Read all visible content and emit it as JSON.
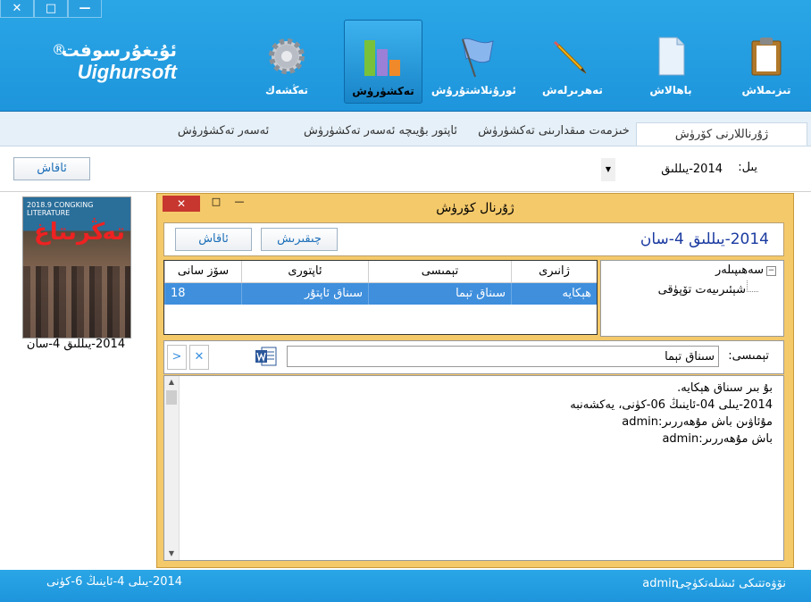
{
  "window": {
    "close": "✕",
    "maximize": "□",
    "minimize": "—"
  },
  "brand": {
    "uyghur": "ئۇيغۇرسوفت",
    "reg": "®",
    "latin": "Uighursoft"
  },
  "toolbar": [
    {
      "label": "تىزىملاش",
      "icon": "clipboard-icon"
    },
    {
      "label": "باھالاش",
      "icon": "document-icon"
    },
    {
      "label": "تەھرىرلەش",
      "icon": "pencil-icon"
    },
    {
      "label": "ئورۇنلاشتۇرۇش",
      "icon": "flag-icon"
    },
    {
      "label": "تەكشۈرۈش",
      "icon": "bar-chart-icon"
    },
    {
      "label": "تەڭشەك",
      "icon": "gear-icon"
    }
  ],
  "tabs": [
    "ژۇرناللارنى كۆرۈش",
    "خىزمەت مىقدارىنى تەكشۈرۈش",
    "ئاپتور بۇيىچە ئەسەر تەكشۈرۈش",
    "ئەسەر تەكشۈرۈش"
  ],
  "filter": {
    "year_label": "يىل:",
    "year_value": "2014-يىللىق",
    "search_button": "ئاقاش"
  },
  "cover": {
    "top_text": "2018.9 CONGKING LITERATURE",
    "title_glyph": "تەڭرىتاغ",
    "caption": "2014-يىللىق 4-سان"
  },
  "dialog": {
    "title": "ژۇرنال كۆرۈش",
    "close": "✕",
    "maximize": "□",
    "minimize": "—",
    "heading": "2014-يىللىق 4-سان",
    "btn_export": "چىقىرىش",
    "btn_search": "ئاقاش",
    "grid": {
      "headers": [
        "ژانىرى",
        "تېمىسى",
        "ئاپتورى",
        "سۆز سانى"
      ],
      "rows": [
        [
          "ھېكايە",
          "سىناق تېما",
          "سىناق ئاپتۇر",
          "18"
        ]
      ]
    },
    "tree": {
      "root": "سەھىپىلەر",
      "child": "شېئىرىيەت تۆپۈقى"
    },
    "search": {
      "label": "تېمىسى:",
      "value": "سىناق تېما",
      "next": ">",
      "clear": "✕"
    },
    "text_lines": [
      "بۇ بىر سىناق ھېكايە.",
      "2014-يىلى 04-ئاينىڭ 06-كۈنى، يەكشەنبە",
      "مۇئاۋىن باش مۇھەررىر:admin",
      "باش مۇھەررىر:admin"
    ]
  },
  "status": {
    "user_label": "نۆۋەتتىكى ئىشلەتكۈچى:",
    "user": "admin",
    "date": "2014-يىلى 4-ئاينىڭ 6-كۈنى"
  }
}
